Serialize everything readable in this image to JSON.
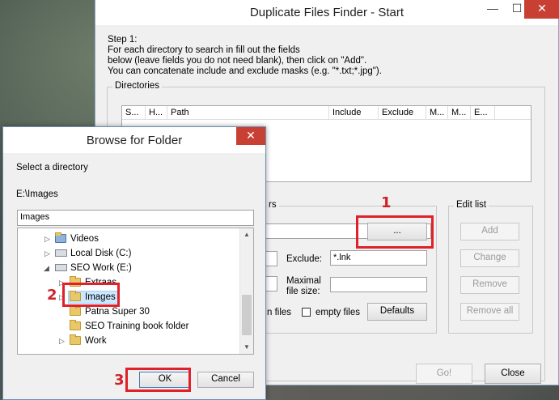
{
  "main": {
    "title": "Duplicate Files Finder - Start",
    "step_lines": [
      "Step 1:",
      "For each directory to search in fill out the fields",
      "below (leave fields you do not need blank), then click on \"Add\".",
      "You can concatenate include and exclude masks (e.g. \"*.txt;*.jpg\")."
    ],
    "directories_caption": "Directories",
    "columns": [
      "S...",
      "H...",
      "Path",
      "Include",
      "Exclude",
      "M...",
      "M...",
      "E..."
    ],
    "partial_group_caption": "rs",
    "browse_button": "...",
    "exclude_label": "Exclude:",
    "exclude_value": "*.lnk",
    "maxsize_label_1": "Maximal",
    "maxsize_label_2": "file size:",
    "hidden_files_label": "n files",
    "empty_files_label": "empty files",
    "defaults_button": "Defaults",
    "editlist_caption": "Edit list",
    "add_button": "Add",
    "change_button": "Change",
    "remove_button": "Remove",
    "removeall_button": "Remove all",
    "go_button": "Go!",
    "close_button": "Close"
  },
  "dialog": {
    "title": "Browse for Folder",
    "prompt": "Select a directory",
    "current_path": "E:\\Images",
    "folder_field": "Images",
    "tree": [
      {
        "label": "Videos",
        "kind": "folder",
        "expander": "closed"
      },
      {
        "label": "Local Disk (C:)",
        "kind": "drive",
        "expander": "closed"
      },
      {
        "label": "SEO Work (E:)",
        "kind": "drive",
        "expander": "open"
      },
      {
        "label": "Extraas",
        "kind": "folder",
        "expander": "closed"
      },
      {
        "label": "Images",
        "kind": "folder",
        "expander": "closed",
        "selected": true
      },
      {
        "label": "Patna Super 30",
        "kind": "folder",
        "expander": "none"
      },
      {
        "label": "SEO Training book folder",
        "kind": "folder",
        "expander": "none"
      },
      {
        "label": "Work",
        "kind": "folder",
        "expander": "closed"
      }
    ],
    "ok_button": "OK",
    "cancel_button": "Cancel"
  },
  "annotations": {
    "step1": "1",
    "step2": "2",
    "step3": "3",
    "color": "#e0202a"
  }
}
